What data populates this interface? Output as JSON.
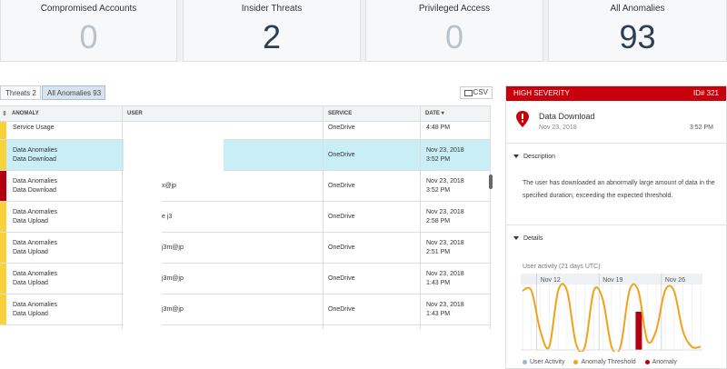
{
  "stats": [
    {
      "title": "Compromised Accounts",
      "value": "0"
    },
    {
      "title": "Insider Threats",
      "value": "2"
    },
    {
      "title": "Privileged Access",
      "value": "0"
    },
    {
      "title": "All Anomalies",
      "value": "93"
    }
  ],
  "tabs": {
    "threats": "Threats 2",
    "all_anomalies": "All Anomalies 93"
  },
  "export": {
    "csv_label": "CSV",
    "icon": "export-icon"
  },
  "table": {
    "headers": {
      "anomaly": "ANOMALY",
      "user": "USER",
      "service": "SERVICE",
      "date": "DATE"
    },
    "rows": [
      {
        "severity_color": "#f7d23a",
        "anomaly_line1": "Service Usage",
        "anomaly_line2": "",
        "user": "",
        "service": "OneDrive",
        "date": "",
        "time": "4:48 PM"
      },
      {
        "severity_color": "#f7d23a",
        "anomaly_line1": "Data Anomalies",
        "anomaly_line2": "Data Download",
        "user": "",
        "service": "OneDrive",
        "date": "Nov 23, 2018",
        "time": "3:52 PM"
      },
      {
        "severity_color": "#b3000e",
        "anomaly_line1": "Data Anomalies",
        "anomaly_line2": "Data Download",
        "user": "x@jp",
        "service": "OneDrive",
        "date": "Nov 23, 2018",
        "time": "3:52 PM"
      },
      {
        "severity_color": "#f7d23a",
        "anomaly_line1": "Data Anomalies",
        "anomaly_line2": "Data Upload",
        "user": "e j3",
        "service": "OneDrive",
        "date": "Nov 23, 2018",
        "time": "2:58 PM"
      },
      {
        "severity_color": "#f7d23a",
        "anomaly_line1": "Data Anomalies",
        "anomaly_line2": "Data Upload",
        "user": "j3m@jp",
        "service": "OneDrive",
        "date": "Nov 23, 2018",
        "time": "2:51 PM"
      },
      {
        "severity_color": "#f7d23a",
        "anomaly_line1": "Data Anomalies",
        "anomaly_line2": "Data Upload",
        "user": "j3m@jp",
        "service": "OneDrive",
        "date": "Nov 23, 2018",
        "time": "1:43 PM"
      },
      {
        "severity_color": "#f7d23a",
        "anomaly_line1": "Data Anomalies",
        "anomaly_line2": "Data Upload",
        "user": "j3m@jp",
        "service": "OneDrive",
        "date": "Nov 23, 2018",
        "time": "1:43 PM"
      }
    ]
  },
  "panel": {
    "severity": "HIGH SEVERITY",
    "id": "ID# 321",
    "title": "Data Download",
    "date": "Nov 23, 2018",
    "time": "3:52 PM",
    "description_heading": "Description",
    "description": "The user has downloaded an abnormally large amount of data in the specified duration, exceeding the expected threshold.",
    "details_heading": "Details",
    "chart_label": "User activity (21 days UTC)",
    "legend": {
      "user_activity": "User Activity",
      "threshold": "Anomaly Threshold",
      "anomaly": "Anomaly"
    },
    "colors": {
      "header": "#c8000b",
      "threshold": "#f2a21a",
      "anomaly": "#b3000e",
      "user_activity": "#9ab8cc"
    }
  },
  "chart_data": {
    "type": "line",
    "title": "User activity (21 days UTC)",
    "xlabel": "",
    "ylabel": "",
    "x_ticks": [
      "Nov 12",
      "Nov 19",
      "Nov 26"
    ],
    "series": [
      {
        "name": "Anomaly Threshold",
        "values": [
          0.93,
          0.93,
          0.3,
          0.05,
          0.93,
          0.93,
          0.1,
          0.05,
          0.93,
          0.8,
          0.05,
          0.05,
          0.93,
          0.93,
          0.15,
          0.3,
          0.93,
          0.93,
          0.3,
          0.05,
          0.05
        ]
      },
      {
        "name": "Anomaly",
        "values": [
          null,
          null,
          null,
          null,
          null,
          null,
          null,
          null,
          null,
          null,
          null,
          null,
          null,
          0.6,
          null,
          null,
          null,
          null,
          null,
          null,
          null
        ]
      }
    ],
    "ylim": [
      0,
      1
    ],
    "grid": true,
    "legend_position": "bottom"
  }
}
